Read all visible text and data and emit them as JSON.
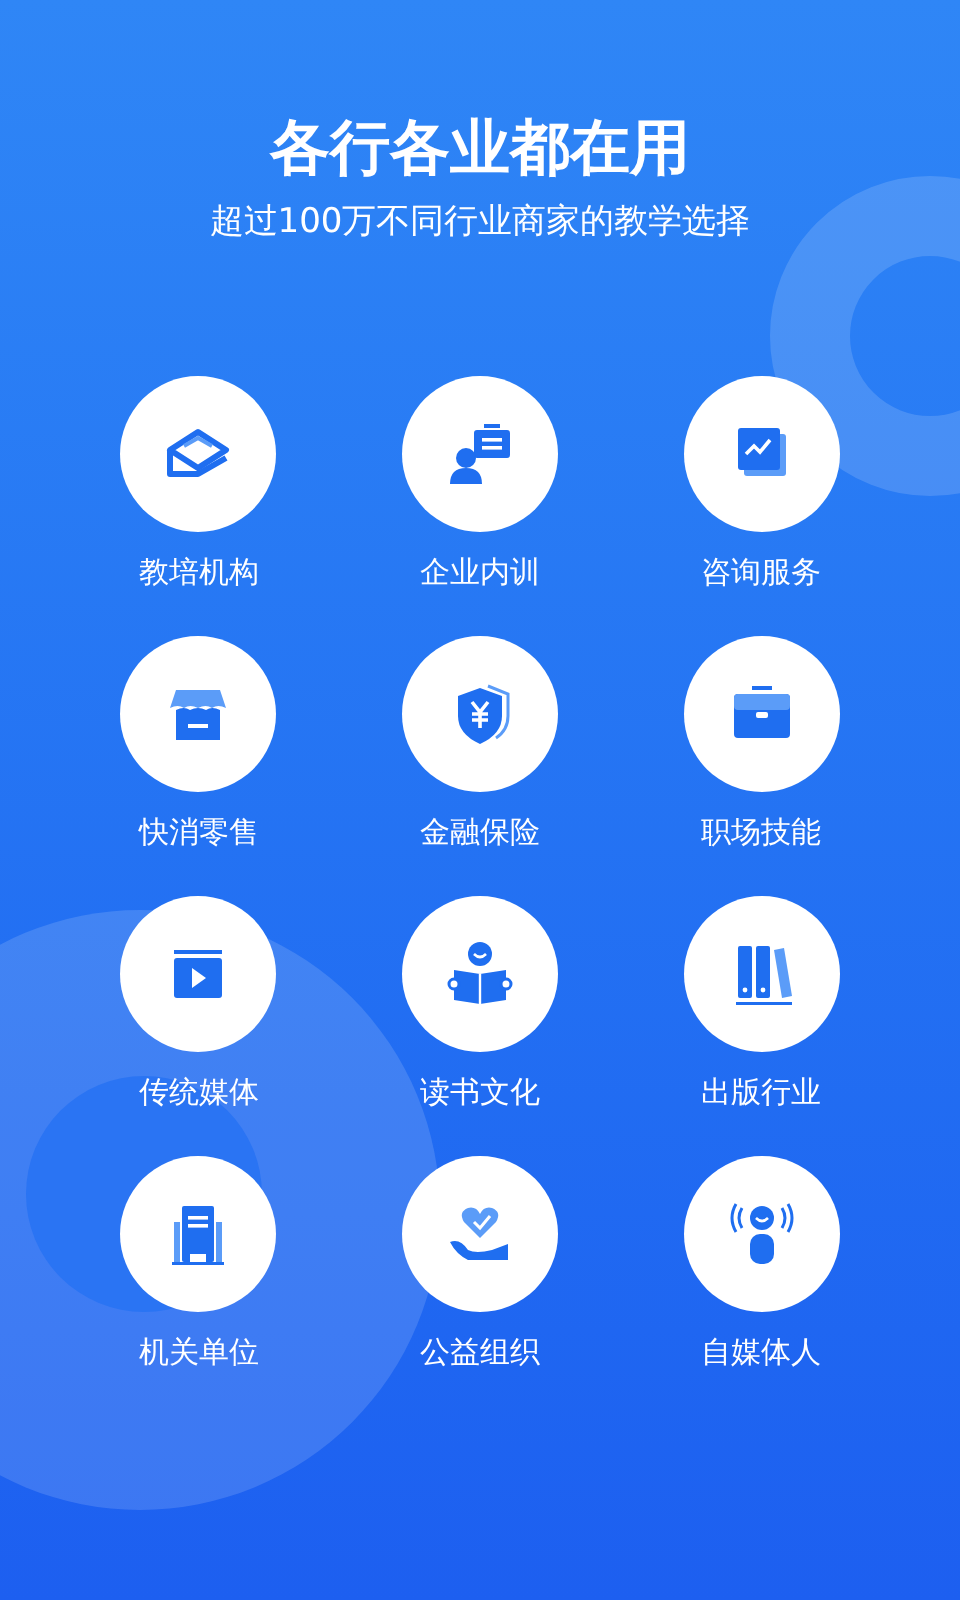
{
  "header": {
    "title": "各行各业都在用",
    "subtitle": "超过100万不同行业商家的教学选择"
  },
  "industries": [
    {
      "label": "教培机构"
    },
    {
      "label": "企业内训"
    },
    {
      "label": "咨询服务"
    },
    {
      "label": "快消零售"
    },
    {
      "label": "金融保险"
    },
    {
      "label": "职场技能"
    },
    {
      "label": "传统媒体"
    },
    {
      "label": "读书文化"
    },
    {
      "label": "出版行业"
    },
    {
      "label": "机关单位"
    },
    {
      "label": "公益组织"
    },
    {
      "label": "自媒体人"
    }
  ]
}
